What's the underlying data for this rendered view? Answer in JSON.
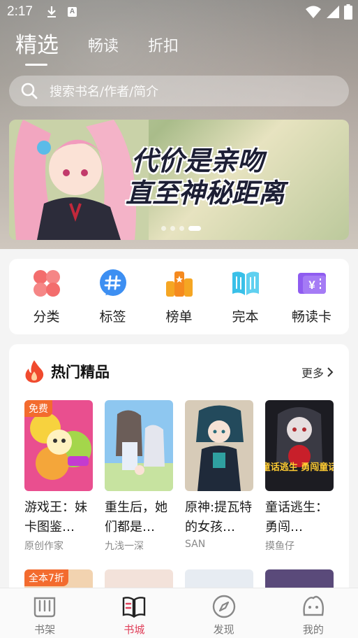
{
  "status_bar": {
    "time": "2:17",
    "a_icon_letter": "A"
  },
  "top_tabs": [
    {
      "label": "精选",
      "active": true
    },
    {
      "label": "畅读",
      "active": false
    },
    {
      "label": "折扣",
      "active": false
    }
  ],
  "search": {
    "placeholder": "搜索书名/作者/简介"
  },
  "banner": {
    "title_line1": "代价是亲吻",
    "title_line2": "直至神秘距离",
    "slide_count": 4,
    "active_slide": 4
  },
  "quick_nav": [
    {
      "label": "分类",
      "icon": "category-icon"
    },
    {
      "label": "标签",
      "icon": "tag-icon"
    },
    {
      "label": "榜单",
      "icon": "ranking-icon"
    },
    {
      "label": "完本",
      "icon": "completed-book-icon"
    },
    {
      "label": "畅读卡",
      "icon": "reading-card-icon"
    }
  ],
  "hot": {
    "title": "热门精品",
    "more": "更多",
    "books": [
      {
        "title": "游戏王：妹卡图鉴…",
        "author": "原创作家",
        "badge": "免费"
      },
      {
        "title": "重生后，她们都是…",
        "author": "九浅一深",
        "badge": ""
      },
      {
        "title": "原神:提瓦特的女孩…",
        "author": "SAN",
        "badge": ""
      },
      {
        "title": "童话逃生：勇闯…",
        "author": "摸鱼仔",
        "badge": ""
      }
    ],
    "second_row_badge": "全本7折",
    "cover4_text": "童话逃生 勇闯童话"
  },
  "bottom_nav": [
    {
      "label": "书架",
      "active": false
    },
    {
      "label": "书城",
      "active": true
    },
    {
      "label": "发现",
      "active": false
    },
    {
      "label": "我的",
      "active": false
    }
  ],
  "colors": {
    "accent": "#e0405a",
    "badge_orange": "#f36b2e",
    "hero_bg": "#9c9790"
  }
}
